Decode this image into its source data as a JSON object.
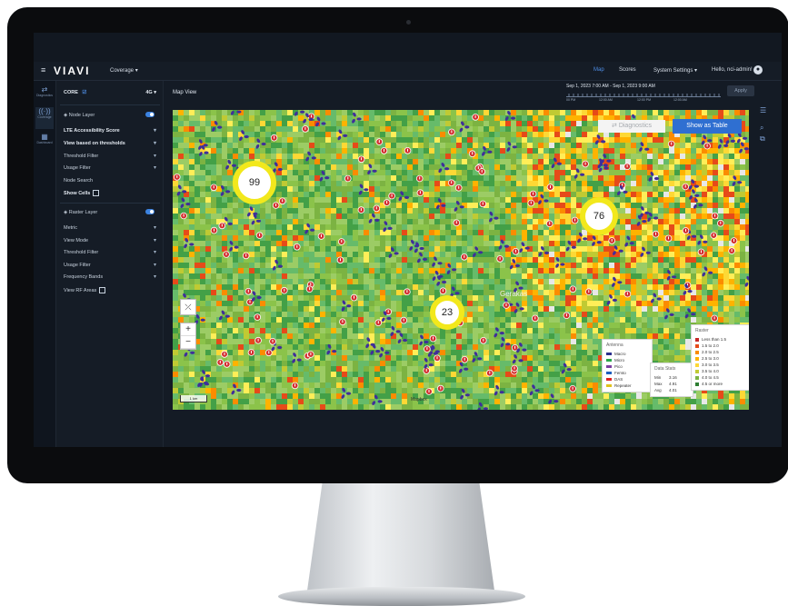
{
  "topbar": {
    "logo": "VIAVI",
    "module": "Coverage",
    "nav": [
      "Map",
      "Scores",
      "System Settings"
    ],
    "greeting": "Hello, nci-admin!",
    "active_nav": "Map"
  },
  "rail": [
    {
      "label": "Diagnostics",
      "icon": "arrows-icon"
    },
    {
      "label": "Coverage",
      "icon": "antenna-icon"
    },
    {
      "label": "Dashboard",
      "icon": "grid-icon"
    }
  ],
  "sidepanel": {
    "selector": "CORE",
    "technology": "4G",
    "node_layer": {
      "title": "Node Layer",
      "items": [
        "LTE Accessibility Score",
        "View based on thresholds",
        "Threshold Filter",
        "Usage Filter",
        "Node Search"
      ],
      "show_cells": "Show Cells"
    },
    "raster_layer": {
      "title": "Raster Layer",
      "items": [
        "Metric",
        "View Mode",
        "Threshold Filter",
        "Usage Filter",
        "Frequency Bands"
      ],
      "view_rf": "View RF Areas"
    }
  },
  "content": {
    "title": "Map View",
    "date_range": "Sep 1, 2023 7:00 AM - Sep 1, 2023 9:00 AM",
    "timeline_ticks": [
      "00 PM",
      "12:00 AM",
      "12:00 PM",
      "12:00 AM"
    ],
    "apply": "Apply"
  },
  "map": {
    "diagnostics": "Diagnostics",
    "show_table": "Show as Table",
    "clusters": [
      {
        "count": "99"
      },
      {
        "count": "76"
      },
      {
        "count": "23"
      }
    ],
    "place_label": "Gerakas",
    "scale": "1 km",
    "attribution": "Mapbox",
    "antenna_legend": {
      "title": "Antenna",
      "items": [
        {
          "label": "Macro",
          "color": "#2b2f8f"
        },
        {
          "label": "Micro",
          "color": "#2aa84a"
        },
        {
          "label": "Pico",
          "color": "#7b3fa0"
        },
        {
          "label": "Femto",
          "color": "#1f5fbf"
        },
        {
          "label": "DAS",
          "color": "#d22"
        },
        {
          "label": "Repeater",
          "color": "#e0c21c"
        }
      ]
    },
    "stats": {
      "title": "Data Stats",
      "rows": [
        {
          "k": "Min",
          "v": "3.16"
        },
        {
          "k": "Max",
          "v": "4.91"
        },
        {
          "k": "Avg",
          "v": "4.01"
        }
      ]
    },
    "raster_legend": {
      "title": "Raster",
      "items": [
        {
          "label": "Less than 1.5",
          "color": "#c62828"
        },
        {
          "label": "1.5 to 2.0",
          "color": "#e64a19"
        },
        {
          "label": "2.0 to 2.5",
          "color": "#fb8c00"
        },
        {
          "label": "2.5 to 3.0",
          "color": "#ffb300"
        },
        {
          "label": "3.0 to 3.5",
          "color": "#fdd835"
        },
        {
          "label": "3.5 to 4.0",
          "color": "#c0ca33"
        },
        {
          "label": "4.0 to 4.5",
          "color": "#7cb342"
        },
        {
          "label": "4.5 or more",
          "color": "#2e7d32"
        }
      ]
    }
  }
}
